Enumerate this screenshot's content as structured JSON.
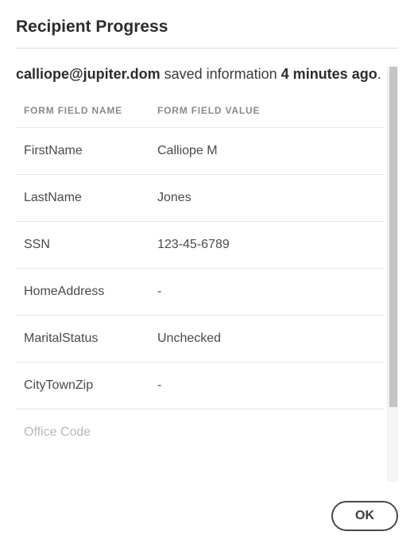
{
  "title": "Recipient Progress",
  "status": {
    "email": "calliope@jupiter.dom",
    "middle": " saved information ",
    "time": "4 minutes ago",
    "suffix": "."
  },
  "table": {
    "header_name": "Form Field Name",
    "header_value": "Form Field Value",
    "rows": [
      {
        "name": "FirstName",
        "value": "Calliope M"
      },
      {
        "name": "LastName",
        "value": "Jones"
      },
      {
        "name": "SSN",
        "value": "123-45-6789"
      },
      {
        "name": "HomeAddress",
        "value": "-"
      },
      {
        "name": "MaritalStatus",
        "value": "Unchecked"
      },
      {
        "name": "CityTownZip",
        "value": "-"
      },
      {
        "name": "Office Code",
        "value": ""
      }
    ]
  },
  "footer": {
    "ok_label": "OK"
  }
}
